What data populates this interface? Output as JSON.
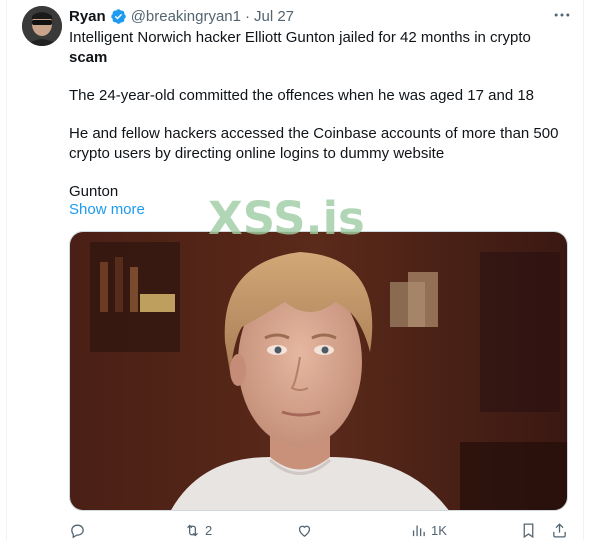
{
  "tweet": {
    "author_name": "Ryan",
    "handle": "@breakingryan1",
    "separator": "·",
    "date": "Jul 27",
    "line1_text": "Intelligent Norwich hacker Elliott Gunton jailed for 42 months in crypto",
    "line1_bold": "scam",
    "paragraph2": "The 24-year-old committed the offences when he was aged 17 and 18",
    "paragraph3": "He and fellow hackers accessed the Coinbase accounts of more than 500 crypto users by directing online logins to dummy website",
    "paragraph4": "Gunton",
    "show_more": "Show more"
  },
  "watermark": "XSS.is",
  "actions": {
    "reply_count": "",
    "retweet_count": "2",
    "like_count": "",
    "views_count": "1K"
  },
  "colors": {
    "accent": "#1d9bf0",
    "muted": "#536471",
    "text": "#0f1419",
    "verified": "#1d9bf0"
  },
  "icons": [
    "avatar",
    "verified-badge-icon",
    "more-icon",
    "reply-icon",
    "retweet-icon",
    "like-icon",
    "views-icon",
    "bookmark-icon",
    "share-icon"
  ]
}
